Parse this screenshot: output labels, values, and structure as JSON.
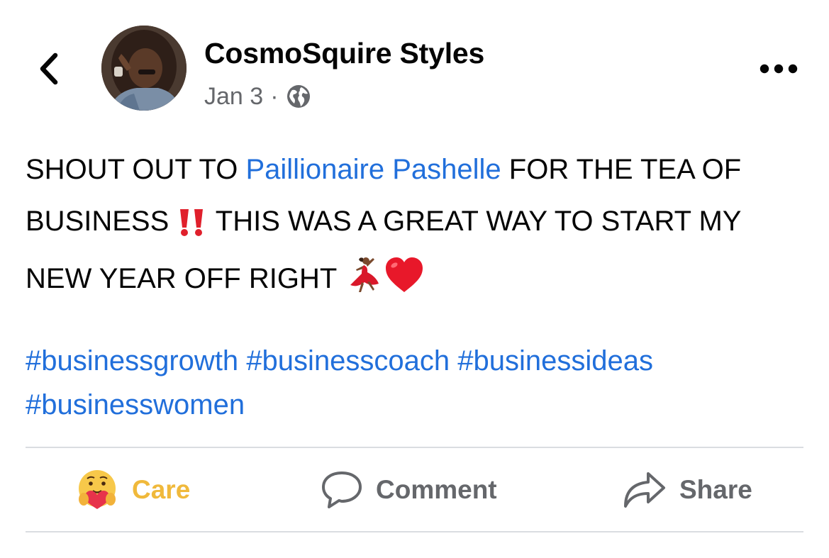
{
  "header": {
    "back_icon": "chevron-left-icon",
    "author_name": "CosmoSquire Styles",
    "date": "Jan 3",
    "separator": "·",
    "audience_icon": "globe-icon",
    "more_icon": "ellipsis-icon"
  },
  "post": {
    "text_part1": "SHOUT OUT TO ",
    "mention": "Paillionaire Pashelle",
    "text_part2": " FOR THE TEA OF BUSINESS ",
    "text_part3": " THIS WAS A GREAT WAY TO START MY NEW YEAR OFF RIGHT ",
    "emoji_1": "double-exclamation-icon",
    "emoji_2": "dancer-icon",
    "emoji_3": "red-heart-icon",
    "hashtags": [
      "#businessgrowth",
      "#businesscoach",
      "#businessideas",
      "#businesswomen"
    ]
  },
  "actions": {
    "care_label": "Care",
    "comment_label": "Comment",
    "share_label": "Share"
  },
  "colors": {
    "link": "#216fdb",
    "care": "#f0b93b",
    "secondary_text": "#65676b",
    "divider": "#dadde1"
  }
}
